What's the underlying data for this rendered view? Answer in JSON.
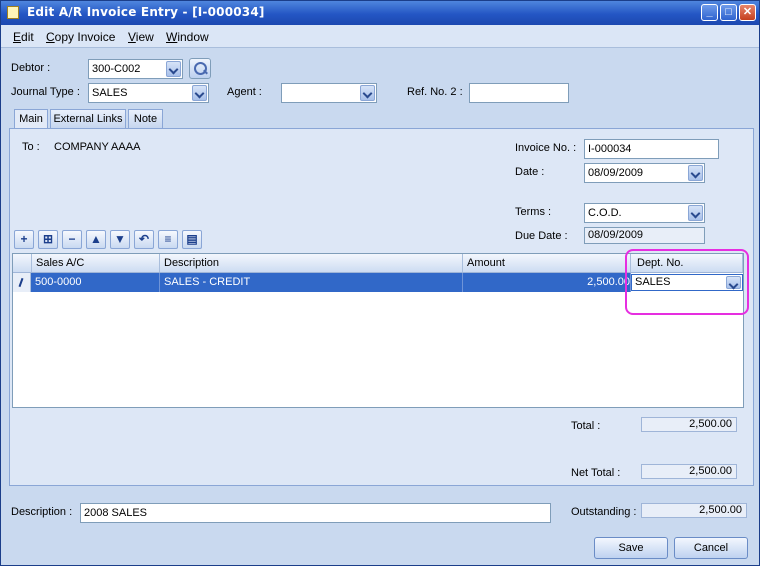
{
  "window": {
    "title": "Edit A/R Invoice Entry - [I-000034]"
  },
  "menu": [
    {
      "label": "Edit",
      "underline": "E",
      "rest": "dit"
    },
    {
      "label": "Copy Invoice",
      "underline": "C",
      "rest": "opy Invoice"
    },
    {
      "label": "View",
      "underline": "V",
      "rest": "iew"
    },
    {
      "label": "Window",
      "underline": "W",
      "rest": "indow"
    }
  ],
  "header": {
    "debtor_label": "Debtor :",
    "debtor_value": "300-C002",
    "journal_label": "Journal Type :",
    "journal_value": "SALES",
    "agent_label": "Agent :",
    "agent_value": "",
    "ref2_label": "Ref. No. 2 :",
    "ref2_value": ""
  },
  "tabs": [
    "Main",
    "External Links",
    "Note"
  ],
  "main": {
    "to_label": "To :",
    "to_value": "COMPANY AAAA",
    "invoice_no_label": "Invoice No. :",
    "invoice_no_value": "I-000034",
    "date_label": "Date :",
    "date_value": "08/09/2009",
    "terms_label": "Terms :",
    "terms_value": "C.O.D.",
    "due_date_label": "Due Date :",
    "due_date_value": "08/09/2009"
  },
  "grid": {
    "columns": [
      "Sales A/C",
      "Description",
      "Amount",
      "Dept. No."
    ],
    "rows": [
      {
        "sales_ac": "500-0000",
        "description": "SALES - CREDIT",
        "amount": "2,500.00",
        "dept_no": "SALES"
      }
    ]
  },
  "totals": {
    "total_label": "Total :",
    "total_value": "2,500.00",
    "net_total_label": "Net Total :",
    "net_total_value": "2,500.00"
  },
  "footer": {
    "description_label": "Description :",
    "description_value": "2008 SALES",
    "outstanding_label": "Outstanding :",
    "outstanding_value": "2,500.00",
    "save_label": "Save",
    "cancel_label": "Cancel"
  },
  "colors": {
    "highlight": "#e62ee0",
    "selected_row": "#3168c8",
    "title_bar": "#2456c4"
  }
}
